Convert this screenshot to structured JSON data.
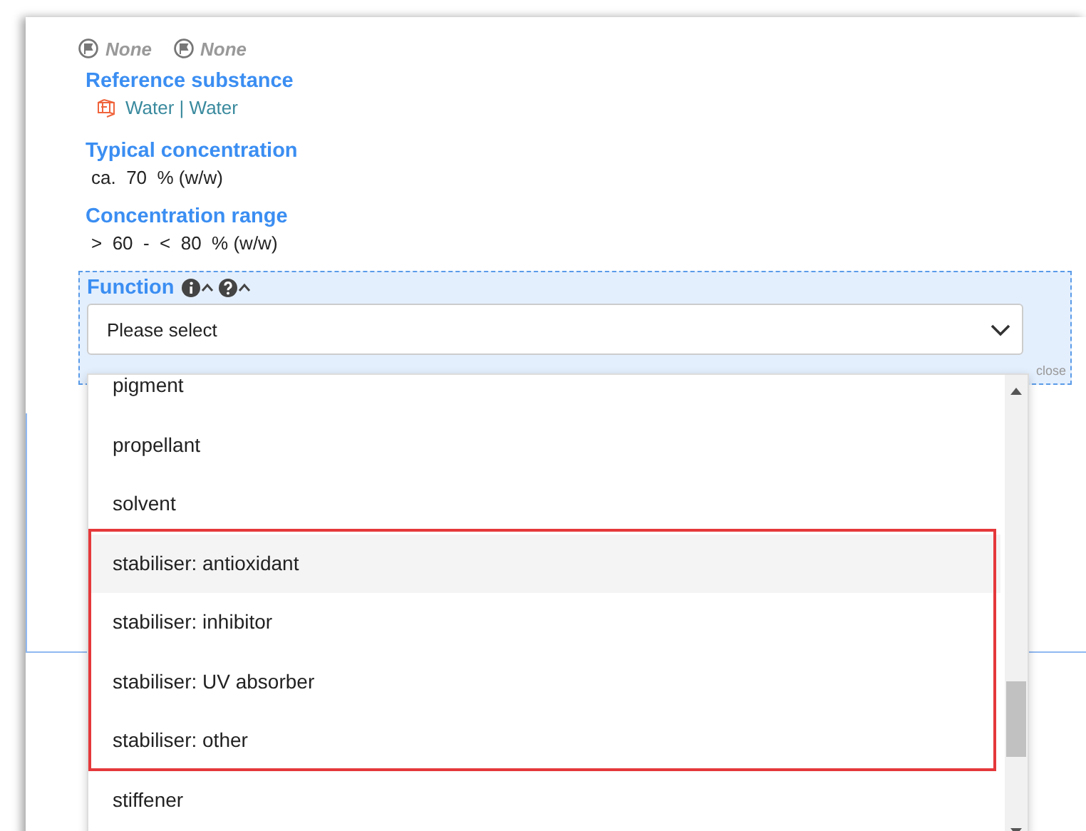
{
  "flags": [
    {
      "text": "None"
    },
    {
      "text": "None"
    }
  ],
  "reference_substance": {
    "label": "Reference substance",
    "value": "Water | Water"
  },
  "typical_concentration": {
    "label": "Typical concentration",
    "value": "ca.  70  % (w/w)"
  },
  "concentration_range": {
    "label": "Concentration range",
    "value": ">  60  -  <  80  % (w/w)"
  },
  "function": {
    "label": "Function",
    "select": {
      "placeholder": "Please select"
    },
    "close": "close",
    "options": [
      {
        "label": "pigment",
        "hovered": false,
        "annotated": false
      },
      {
        "label": "propellant",
        "hovered": false,
        "annotated": false
      },
      {
        "label": "solvent",
        "hovered": false,
        "annotated": false
      },
      {
        "label": "stabiliser: antioxidant",
        "hovered": true,
        "annotated": true
      },
      {
        "label": "stabiliser: inhibitor",
        "hovered": false,
        "annotated": true
      },
      {
        "label": "stabiliser: UV absorber",
        "hovered": false,
        "annotated": true
      },
      {
        "label": "stabiliser: other",
        "hovered": false,
        "annotated": true
      },
      {
        "label": "stiffener",
        "hovered": false,
        "annotated": false
      }
    ]
  }
}
